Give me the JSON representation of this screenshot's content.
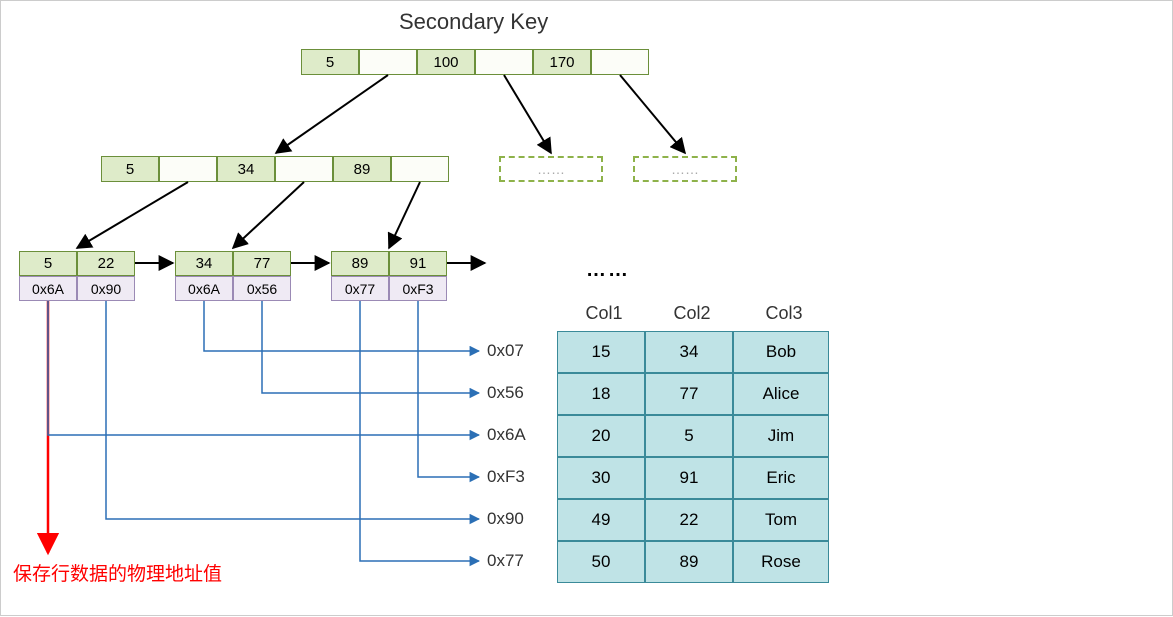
{
  "title": "Secondary Key",
  "root_node": {
    "cells": [
      "5",
      "",
      "100",
      "",
      "170",
      ""
    ]
  },
  "mid_node": {
    "cells": [
      "5",
      "",
      "34",
      "",
      "89",
      ""
    ]
  },
  "leaf_nodes": [
    {
      "keys": [
        "5",
        "22"
      ],
      "addrs": [
        "0x6A",
        "0x90"
      ]
    },
    {
      "keys": [
        "34",
        "77"
      ],
      "addrs": [
        "0x6A",
        "0x56"
      ]
    },
    {
      "keys": [
        "89",
        "91"
      ],
      "addrs": [
        "0x77",
        "0xF3"
      ]
    }
  ],
  "dashed_placeholder": "……",
  "leaf_ellipsis": "……",
  "red_annotation": "保存行数据的物理地址值",
  "table": {
    "headers": [
      "Col1",
      "Col2",
      "Col3"
    ],
    "row_addrs": [
      "0x07",
      "0x56",
      "0x6A",
      "0xF3",
      "0x90",
      "0x77"
    ],
    "rows": [
      [
        "15",
        "34",
        "Bob"
      ],
      [
        "18",
        "77",
        "Alice"
      ],
      [
        "20",
        "5",
        "Jim"
      ],
      [
        "30",
        "91",
        "Eric"
      ],
      [
        "49",
        "22",
        "Tom"
      ],
      [
        "50",
        "89",
        "Rose"
      ]
    ]
  },
  "colors": {
    "node_fill": "#deebc9",
    "node_border": "#6b8f3a",
    "addr_fill": "#efeaf4",
    "addr_border": "#9b8ab5",
    "table_fill": "#bfe3e6",
    "table_border": "#3a8a99",
    "arrow_black": "#000000",
    "arrow_blue": "#2b6fb5",
    "arrow_red": "#ff0000"
  }
}
